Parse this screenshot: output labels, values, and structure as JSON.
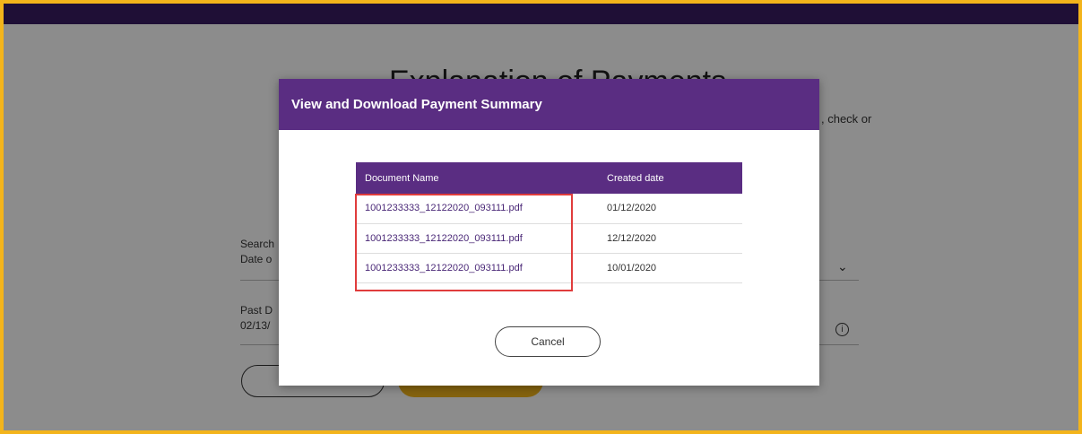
{
  "background": {
    "page_title": "Explanation of Payments",
    "subtext_fragment": ", check or",
    "search_label_fragment": "Search",
    "search_value_fragment": "Date o",
    "past_date_label_fragment": "Past D",
    "past_date_value_fragment": "02/13/",
    "info_icon": "info-icon",
    "chevron_icon": "chevron-down-icon"
  },
  "modal": {
    "title": "View and Download Payment Summary",
    "table": {
      "headers": [
        "Document Name",
        "Created date"
      ],
      "rows": [
        {
          "document_name": "1001233333_12122020_093111.pdf",
          "created_date": "01/12/2020"
        },
        {
          "document_name": "1001233333_12122020_093111.pdf",
          "created_date": "12/12/2020"
        },
        {
          "document_name": "1001233333_12122020_093111.pdf",
          "created_date": "10/01/2020"
        }
      ]
    },
    "cancel_label": "Cancel"
  },
  "colors": {
    "brand_purple": "#5a2d82",
    "top_bar": "#3a1d63",
    "accent_yellow": "#f3b41b",
    "highlight_red": "#e03c3c"
  }
}
